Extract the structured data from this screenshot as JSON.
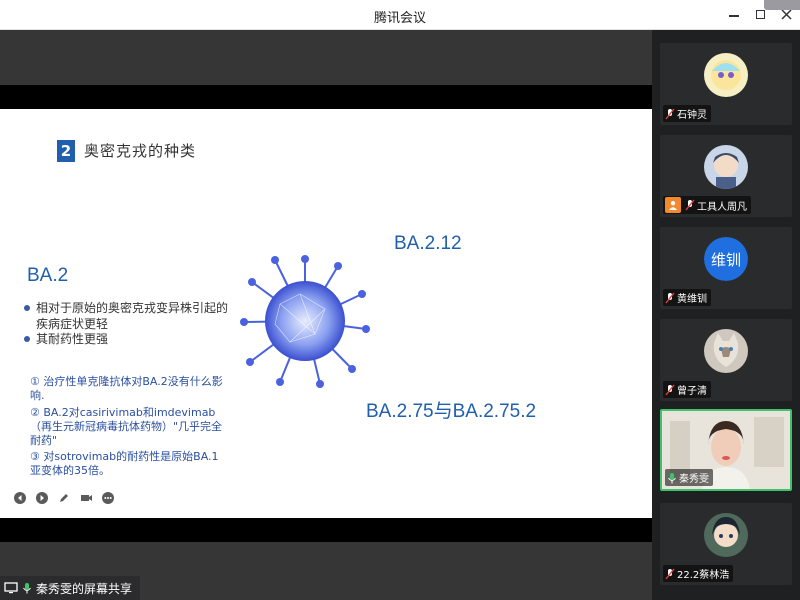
{
  "window": {
    "title": "腾讯会议"
  },
  "slide": {
    "section_number": "2",
    "section_title": "奥密克戎的种类",
    "variant_main": "BA.2",
    "bullets": [
      "相对于原始的奥密克戎变异株引起的疾病症状更轻",
      "其耐药性更强"
    ],
    "notes": [
      "① 治疗性单克隆抗体对BA.2没有什么影响.",
      "② BA.2对casirivimab和imdevimab（再生元新冠病毒抗体药物）\"几乎完全耐药\"",
      "③ 对sotrovimab的耐药性是原始BA.1亚变体的35倍。"
    ],
    "variant_a": "BA.2.12",
    "variant_b": "BA.2.75与BA.2.75.2"
  },
  "share_status": {
    "label": "秦秀雯的屏幕共享"
  },
  "participants": [
    {
      "name": "石钟灵",
      "avatar": "cartoon-avatar",
      "muted": true
    },
    {
      "name": "工具人周凡",
      "avatar": "anime-avatar",
      "muted": true,
      "host": true
    },
    {
      "name": "黄维钏",
      "avatar_text": "维钏",
      "muted": true
    },
    {
      "name": "曾子清",
      "avatar": "cat-avatar",
      "muted": true
    },
    {
      "name": "秦秀雯",
      "avatar": "camera-video",
      "muted": false,
      "speaking": true
    },
    {
      "name": "22.2蔡林浩",
      "avatar": "anime-avatar",
      "muted": true
    }
  ],
  "colors": {
    "accent_blue": "#1f5fae",
    "speaking_green": "#3ec26a",
    "muted_red": "#e0433b",
    "host_orange": "#f08a2c"
  }
}
